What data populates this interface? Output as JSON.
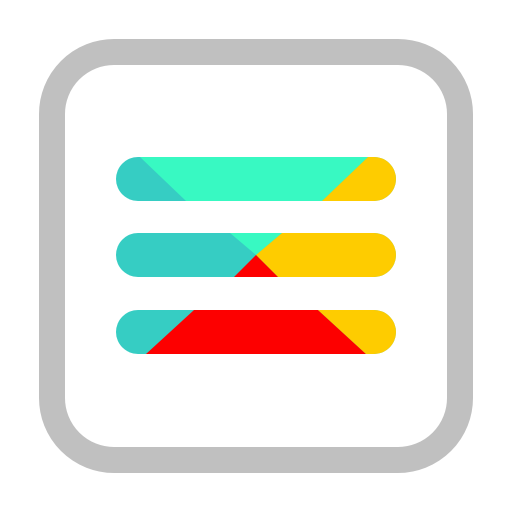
{
  "icon": {
    "name": "menu-icon",
    "kind": "app-icon",
    "colors": {
      "background": "#ffffff",
      "frame": "#c0c0c0",
      "inner": "#ffffff",
      "teal": "#36cdc3",
      "mint": "#38f9c2",
      "yellow": "#fecc00",
      "red": "#fd0000"
    }
  }
}
